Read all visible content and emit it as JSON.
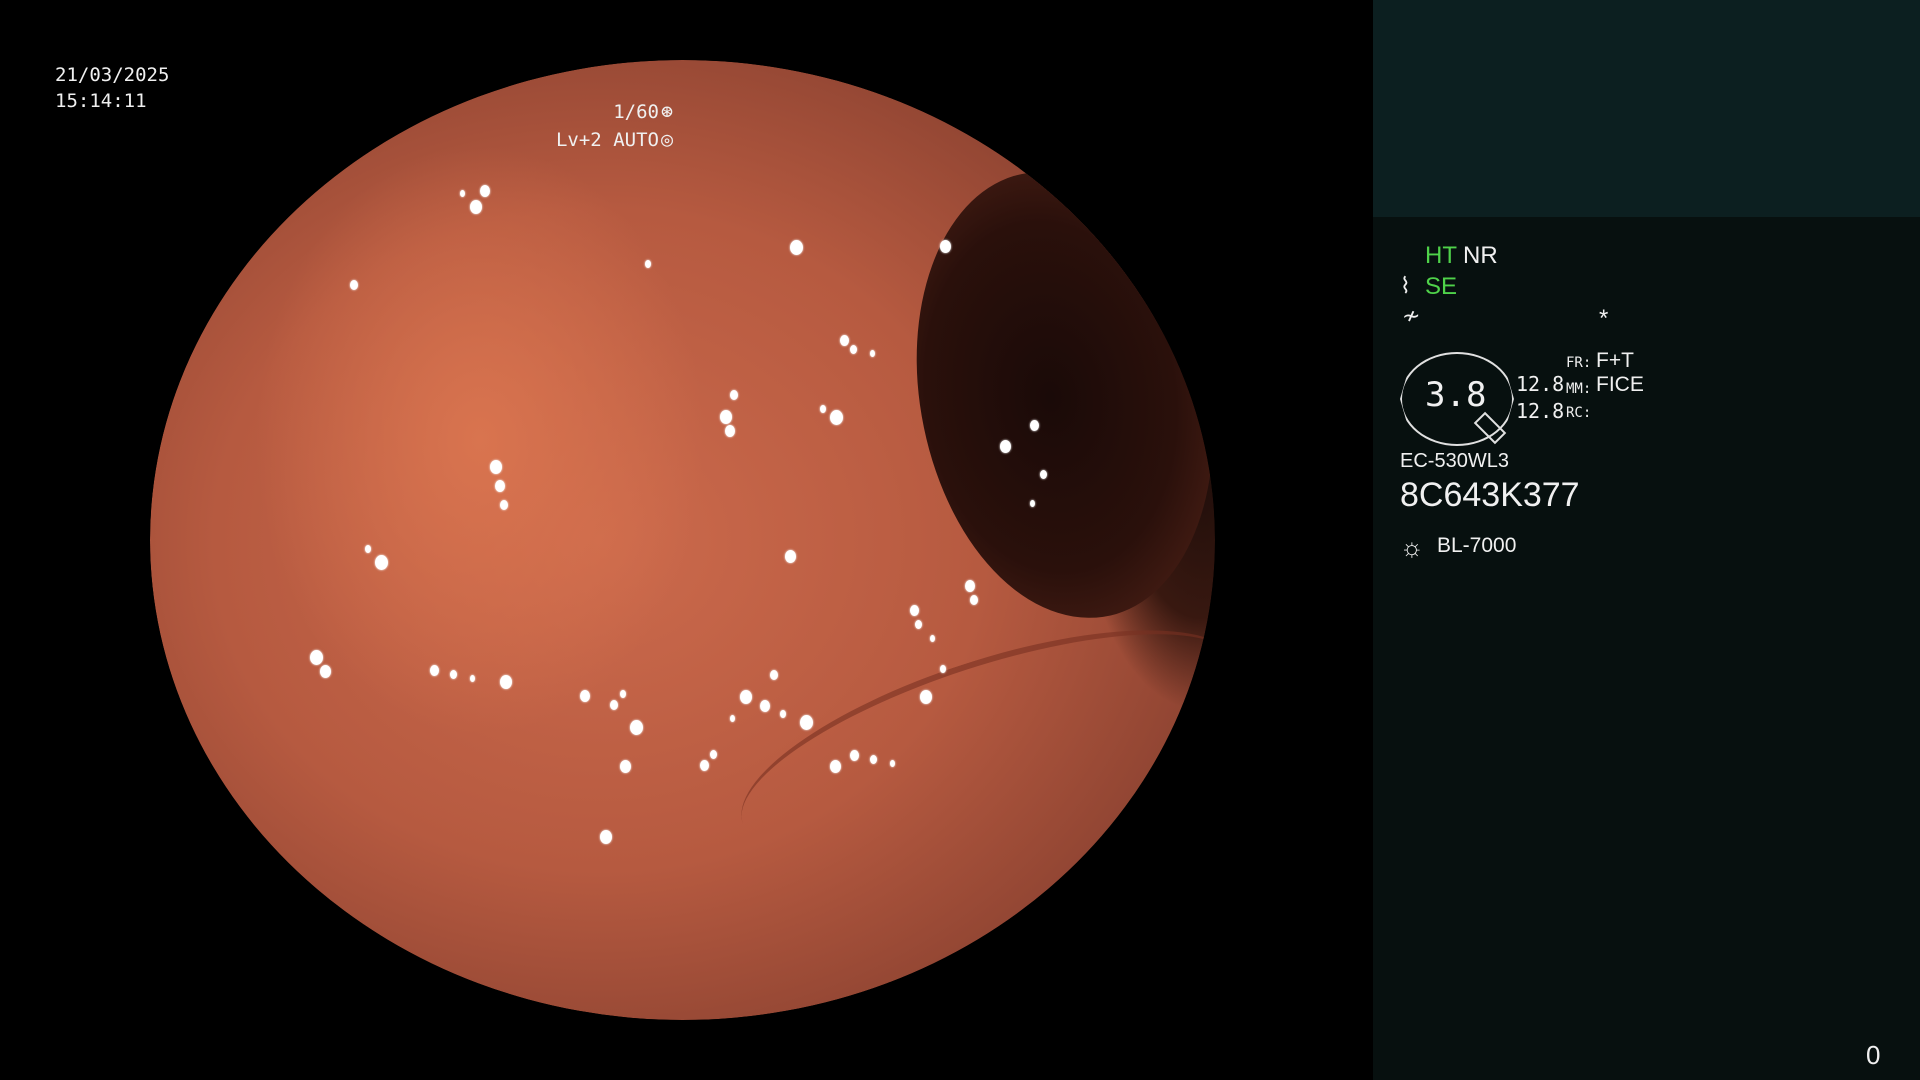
{
  "overlay": {
    "date": "21/03/2025",
    "time": "15:14:11",
    "shutter": "1/60",
    "shutter_icon": "aperture-icon",
    "brightness_level": "Lv+2",
    "iris_mode": "AUTO",
    "iris_icon": "iris-icon"
  },
  "settings_panel": {
    "hyper_tone": "HT",
    "noise_reduction": "NR",
    "structure_enhancement": "SE",
    "star": "*",
    "gauge_value": "3.8",
    "zoom_values": [
      "12.8",
      "12.8"
    ],
    "fr_label": "FR:",
    "fr_value": "F+T",
    "mm_label": "MM:",
    "mm_value": "FICE",
    "rc_label": "RC:",
    "scope_model": "EC-530WL3",
    "scope_serial": "8C643K377",
    "light_source": "BL-7000",
    "frame_count": "0"
  },
  "colors": {
    "active_setting": "#4fd24a",
    "panel_background": "#07100f",
    "panel_top_background": "#0c1f20"
  }
}
